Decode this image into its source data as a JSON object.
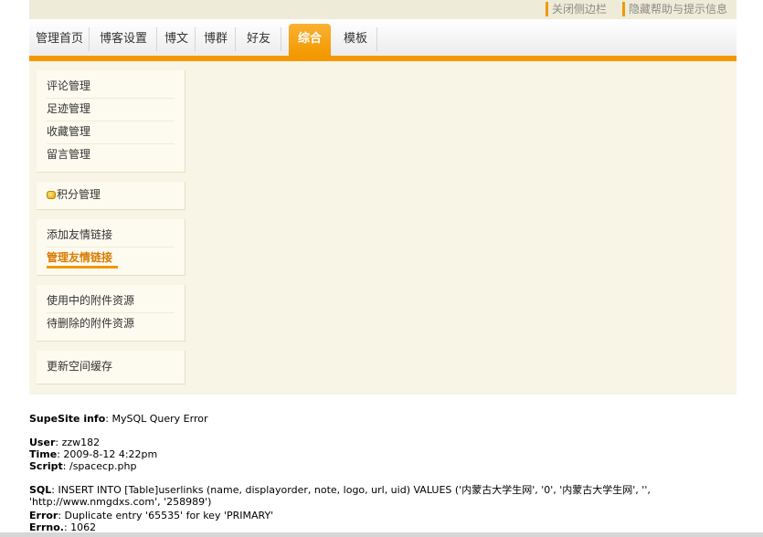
{
  "toplinks": {
    "hide_sidebar": "关闭侧边栏",
    "hide_help": "隐藏帮助与提示信息"
  },
  "tabs": [
    {
      "label": "管理首页"
    },
    {
      "label": "博客设置"
    },
    {
      "label": "博文"
    },
    {
      "label": "博群"
    },
    {
      "label": "好友"
    },
    {
      "label": "综合",
      "active": true
    },
    {
      "label": "模板"
    }
  ],
  "sidebar": {
    "group1": [
      "评论管理",
      "足迹管理",
      "收藏管理",
      "留言管理"
    ],
    "group2": [
      "积分管理"
    ],
    "group3": [
      "添加友情链接",
      "管理友情链接"
    ],
    "group4": [
      "使用中的附件资源",
      "待删除的附件资源"
    ],
    "group5": [
      "更新空间缓存"
    ]
  },
  "error": {
    "info_label": "SupeSite info",
    "info_value": ": MySQL Query Error",
    "user_label": "User",
    "user_value": ": zzw182",
    "time_label": "Time",
    "time_value": ": 2009-8-12 4:22pm",
    "script_label": "Script",
    "script_value": ": /spacecp.php",
    "sql_label": "SQL",
    "sql_value": ": INSERT INTO [Table]userlinks (name, displayorder, note, logo, url, uid) VALUES ('内蒙古大学生网', '0', '内蒙古大学生网', '', 'http://www.nmgdxs.com', '258989')",
    "error_label": "Error",
    "error_value": ": Duplicate entry '65535' for key 'PRIMARY'",
    "errno_label": "Errno.",
    "errno_value": ": 1062"
  },
  "colors": {
    "accent": "#f39800",
    "panel_bg": "#f8f4e6"
  }
}
